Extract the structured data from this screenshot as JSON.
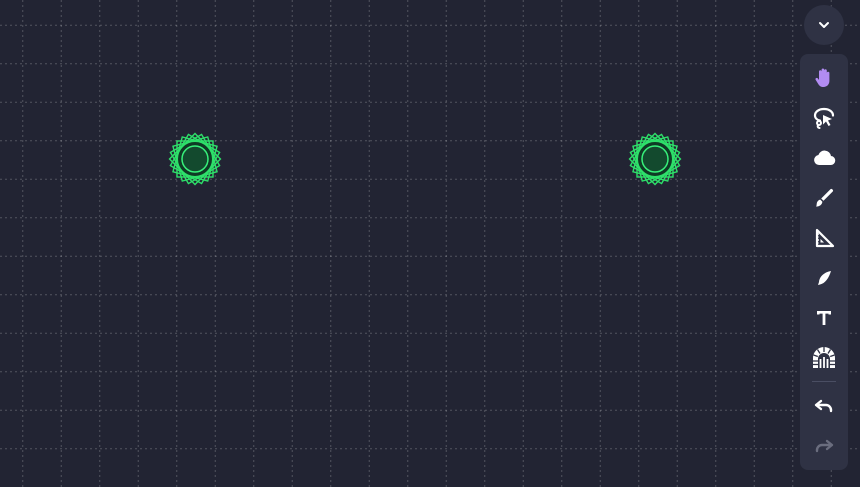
{
  "colors": {
    "background": "#222433",
    "toolbar": "#2f3244",
    "accent": "#b28cf2",
    "icon": "#ffffff",
    "icon_disabled": "#6a6d7e",
    "token_stroke": "#2ee06a",
    "token_fill": "#0f3a25"
  },
  "map": {
    "tokens": [
      {
        "name": "token-1",
        "icon": "green-aura-token"
      },
      {
        "name": "token-2",
        "icon": "green-aura-token"
      }
    ]
  },
  "toolbar": {
    "collapse_icon": "chevron-down-icon",
    "tools": [
      {
        "name": "move-tool",
        "icon": "hand-icon",
        "active": true
      },
      {
        "name": "select-tool",
        "icon": "lasso-cursor-icon",
        "active": false
      },
      {
        "name": "fog-tool",
        "icon": "cloud-icon",
        "active": false
      },
      {
        "name": "draw-tool",
        "icon": "brush-icon",
        "active": false
      },
      {
        "name": "measure-tool",
        "icon": "ruler-triangle-icon",
        "active": false
      },
      {
        "name": "pointer-tool",
        "icon": "quill-icon",
        "active": false
      },
      {
        "name": "text-tool",
        "icon": "text-icon",
        "active": false
      },
      {
        "name": "dungeon-tool",
        "icon": "dungeon-icon",
        "active": false
      }
    ],
    "actions": [
      {
        "name": "undo",
        "icon": "undo-icon",
        "enabled": true
      },
      {
        "name": "redo",
        "icon": "redo-icon",
        "enabled": false
      }
    ]
  }
}
